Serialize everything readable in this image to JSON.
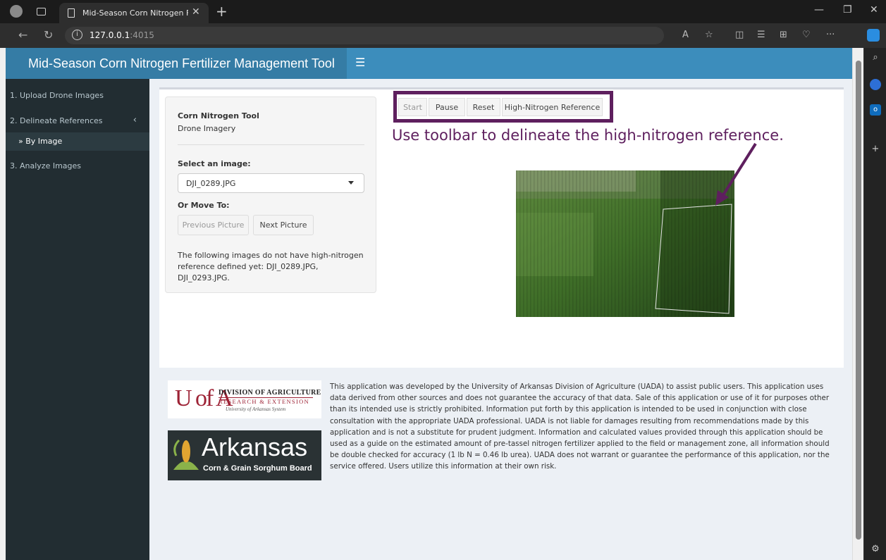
{
  "browser": {
    "tab_title": "Mid-Season Corn Nitrogen Fertili",
    "url_host": "127.0.0.1",
    "url_port": ":4015"
  },
  "app": {
    "title": "Mid-Season Corn Nitrogen Fertilizer Management Tool",
    "brand_color": "#3c8dbc",
    "accent_color": "#5e1f5e"
  },
  "sidebar": {
    "items": [
      {
        "label": "1. Upload Drone Images"
      },
      {
        "label": "2. Delineate References"
      },
      {
        "label": "3. Analyze Images"
      }
    ],
    "subitem": "By Image"
  },
  "panel": {
    "title": "Corn Nitrogen Tool",
    "subtitle": "Drone Imagery",
    "select_label": "Select an image:",
    "selected_image": "DJI_0289.JPG",
    "move_label": "Or Move To:",
    "prev_button": "Previous Picture",
    "next_button": "Next Picture",
    "note": "The following images do not have high-nitrogen reference defined yet: DJI_0289.JPG, DJI_0293.JPG."
  },
  "toolbar": {
    "start": "Start",
    "pause": "Pause",
    "reset": "Reset",
    "reference": "High-Nitrogen Reference"
  },
  "instruction": "Use toolbar to delineate the high-nitrogen reference.",
  "footer": {
    "ua_letters": "U of A",
    "ua_line1": "DIVISION OF AGRICULTURE",
    "ua_line2": "RESEARCH & EXTENSION",
    "ua_line3": "University of Arkansas System",
    "ar_line1": "Arkansas",
    "ar_line2": "Corn & Grain Sorghum Board",
    "disclaimer": "This application was developed by the University of Arkansas Division of Agriculture (UADA) to assist public users. This application uses data derived from other sources and does not guarantee the accuracy of that data. Sale of this application or use of it for purposes other than its intended use is strictly prohibited. Information put forth by this application is intended to be used in conjunction with close consultation with the appropriate UADA professional. UADA is not liable for damages resulting from recommendations made by this application and is not a substitute for prudent judgment. Information and calculated values provided through this application should be used as a guide on the estimated amount of pre-tassel nitrogen fertilizer applied to the field or management zone, all information should be double checked for accuracy (1 lb N = 0.46 lb urea). UADA does not warrant or guarantee the performance of this application, nor the service offered. Users utilize this information at their own risk."
  }
}
